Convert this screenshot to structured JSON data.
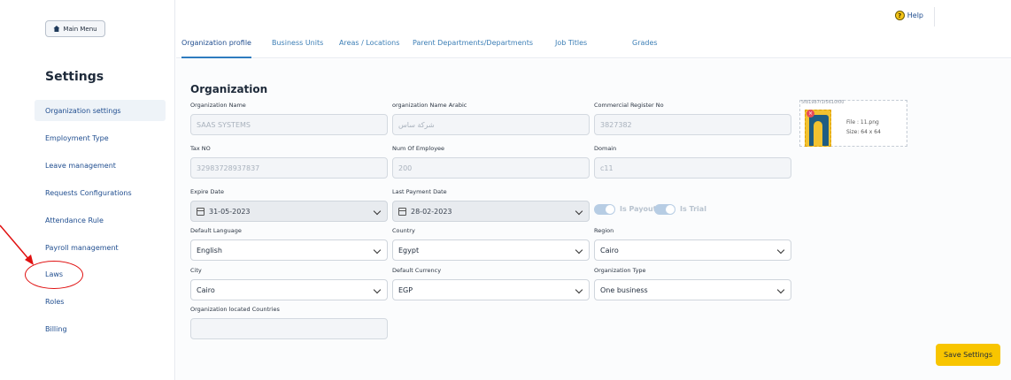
{
  "sidebar": {
    "main_menu_label": "Main Menu",
    "title": "Settings",
    "items": [
      {
        "label": "Organization settings",
        "active": true
      },
      {
        "label": "Employment Type"
      },
      {
        "label": "Leave management"
      },
      {
        "label": "Requests Configurations"
      },
      {
        "label": "Attendance Rule"
      },
      {
        "label": "Payroll management"
      },
      {
        "label": "Laws",
        "highlighted": true
      },
      {
        "label": "Roles"
      },
      {
        "label": "Billing"
      }
    ]
  },
  "header": {
    "help_label": "Help",
    "tabs": [
      {
        "label": "Organization profile",
        "active": true
      },
      {
        "label": "Business Units"
      },
      {
        "label": "Areas / Locations"
      },
      {
        "label": "Parent Departments/Departments"
      },
      {
        "label": "Job Titles"
      },
      {
        "label": "Grades"
      }
    ]
  },
  "form": {
    "section_title": "Organization",
    "org_name": {
      "label": "Organization Name",
      "value": "SAAS SYSTEMS"
    },
    "org_name_ar": {
      "label": "organization Name Arabic",
      "value": "شركة ساس"
    },
    "commercial_register": {
      "label": "Commercial Register No",
      "value": "3827382"
    },
    "tax_no": {
      "label": "Tax NO",
      "value": "32983728937837"
    },
    "num_employees": {
      "label": "Num Of Employee",
      "value": "200"
    },
    "domain": {
      "label": "Domain",
      "value": "c11"
    },
    "expire_date": {
      "label": "Expire Date",
      "value": "31-05-2023"
    },
    "last_payment": {
      "label": "Last Payment Date",
      "value": "28-02-2023"
    },
    "is_payout_label": "Is Payout",
    "is_trial_label": "Is Trial",
    "default_language": {
      "label": "Default Language",
      "value": "English"
    },
    "country": {
      "label": "Country",
      "value": "Egypt"
    },
    "region": {
      "label": "Region",
      "value": "Cairo"
    },
    "city": {
      "label": "City",
      "value": "Cairo"
    },
    "default_currency": {
      "label": "Default Currency",
      "value": "EGP"
    },
    "org_type": {
      "label": "Organization Type",
      "value": "One business"
    },
    "located_countries": {
      "label": "Organization located Countries",
      "value": ""
    }
  },
  "upload": {
    "filename": "5f81987f1f5610f00",
    "file_line": "File : 11.png",
    "size_line": "Size: 64 x 64"
  },
  "actions": {
    "save_label": "Save Settings"
  },
  "colors": {
    "accent": "#2f7cbf",
    "save": "#f8c500",
    "annotation": "#e01010"
  }
}
